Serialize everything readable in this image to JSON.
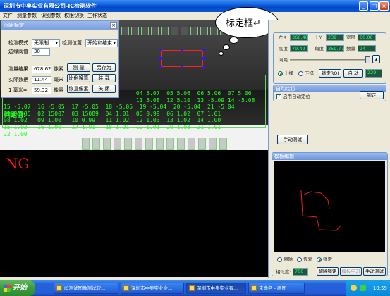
{
  "window": {
    "title": "深圳市中奥实业有限公司-IC检测软件"
  },
  "menu": [
    "文件",
    "测量参数",
    "识别参数",
    "权限切换",
    "工作状态"
  ],
  "dialog": {
    "title": "间距标定",
    "detect_mode_label": "检测模式",
    "detect_mode_value": "无限制",
    "detect_pos_label": "检测位置",
    "detect_pos_value": "开始和结束",
    "edge_threshold_label": "边缘阈值",
    "edge_threshold_value": "30",
    "measure_result_label": "测量结果",
    "measure_result_value": "678.62",
    "measure_result_unit": "像素",
    "actual_value_label": "实际数据",
    "actual_value_value": "11.44",
    "actual_value_unit": "毫米",
    "mm_label": "1 毫米=",
    "mm_value": "59.32",
    "mm_unit": "像素",
    "buttons": {
      "measure": "测 量",
      "save_as": "另存为",
      "ratio": "比例换算",
      "load": "装 载",
      "restore_pixel": "恢复像素",
      "close": "关 闭"
    }
  },
  "measure": {
    "label": "间距值:",
    "rows": [
      "                                       04 5.07  05 5.06  06 5.06  07 5.06",
      "                                       11 5.08  12 5.10  13 -5.09 14 -5.08",
      "15 -5.07  16 -5.05  17 -5.05  18 -5.05  19 -5.04  20 -5.04  21 -5.04",
      "01 05985  02 15007  03 15089  04 1.01  05 0.99  06 1.02  07 1.01",
      "08 1.02   09 1.00   10 0.99   11 1.02  12 1.03  13 1.02  14 1.00",
      "15 1.03   16 1.00   17 1.01   18 1.01  19 1.01  20 1.03  21 1.01",
      "22 1.00"
    ]
  },
  "ng_text": "NG",
  "callout": {
    "text": "标定框↵"
  },
  "right_panel": {
    "roi": {
      "left_label": "左X",
      "left_value": "366.40",
      "top_label": "上Y",
      "top_value": "239",
      "width_label": "宽度",
      "width_value": "60.00",
      "height_label": "高度",
      "height_value": "79.42",
      "angle_label": "角度",
      "angle_value": "359.77",
      "count_label": "数量",
      "count_value": "24",
      "gap_label": "间距",
      "radio_up": "上择",
      "radio_down": "下择",
      "lock_roi": "锁定ROI",
      "auto": "自 动",
      "auto_value": "229"
    },
    "autolocate": {
      "title": "自动定位",
      "enable_label": "启用自动定位",
      "lock": "锁定"
    },
    "manual_test": "手动测试",
    "template": {
      "title": "模板编辑",
      "radio_erase": "擦除",
      "radio_restore": "恢复",
      "radio_lock": "锁定",
      "similarity_label": "相似度:",
      "similarity_value": "700",
      "unlock": "解除锁定",
      "learn": "模板学习",
      "manual_test": "手动测试"
    }
  },
  "taskbar": {
    "start": "开始",
    "tasks": [
      "IC测试图像测试软...",
      "深圳市中奥实业企...",
      "深圳市中奥实业有...",
      "未命名 - 画图"
    ],
    "clock": "10:59"
  },
  "colors": {
    "green_text": "#22ff22",
    "ng_red": "#ff1010",
    "titlebar": "#0a5ad8"
  }
}
